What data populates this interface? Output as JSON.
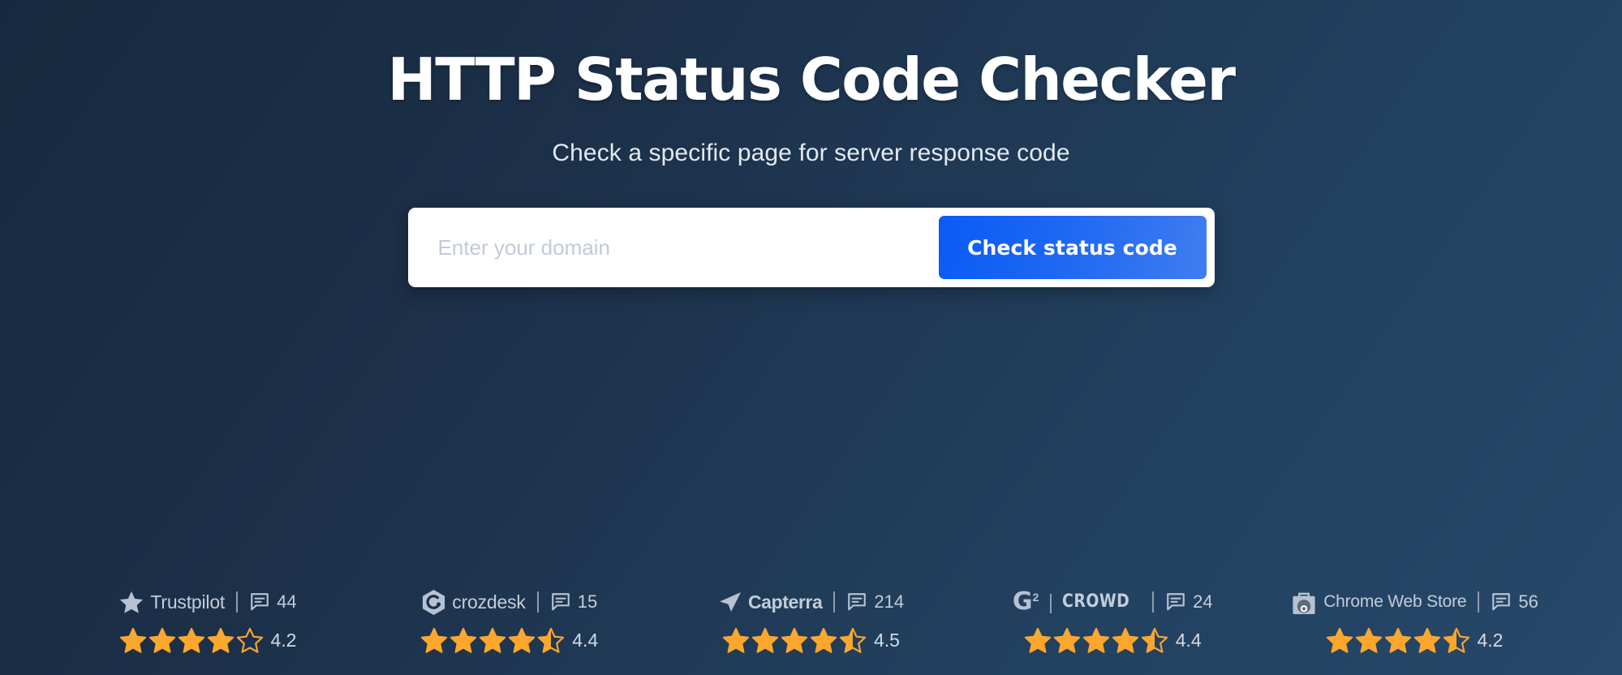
{
  "hero": {
    "title": "HTTP Status Code Checker",
    "subtitle": "Check a specific page for server response code"
  },
  "search": {
    "placeholder": "Enter your domain",
    "value": "",
    "button_label": "Check status code"
  },
  "colors": {
    "background_start": "#16293f",
    "background_end": "#27486a",
    "button_gradient_start": "#0a5bf6",
    "button_gradient_end": "#3f7df0",
    "star_filled": "#fba72e",
    "text_muted": "#c3ccd9"
  },
  "badges": [
    {
      "brand": "Trustpilot",
      "logo_icon": "star-icon",
      "review_icon": "comment-icon",
      "review_count": "44",
      "rating": "4.2",
      "stars": [
        "full",
        "full",
        "full",
        "full",
        "empty"
      ]
    },
    {
      "brand": "crozdesk",
      "logo_icon": "crozdesk-hexagon-icon",
      "review_icon": "comment-icon",
      "review_count": "15",
      "rating": "4.4",
      "stars": [
        "full",
        "full",
        "full",
        "full",
        "half"
      ]
    },
    {
      "brand": "Capterra",
      "logo_icon": "capterra-arrow-icon",
      "review_icon": "comment-icon",
      "review_count": "214",
      "rating": "4.5",
      "stars": [
        "full",
        "full",
        "full",
        "full",
        "half"
      ]
    },
    {
      "brand": "CROWD",
      "brand_prefix": "G",
      "brand_superscript": "2",
      "logo_icon": "g2-crowd-icon",
      "review_icon": "comment-icon",
      "review_count": "24",
      "rating": "4.4",
      "stars": [
        "full",
        "full",
        "full",
        "full",
        "half"
      ]
    },
    {
      "brand": "Chrome Web Store",
      "logo_icon": "chrome-web-store-bag-icon",
      "review_icon": "comment-icon",
      "review_count": "56",
      "rating": "4.2",
      "stars": [
        "full",
        "full",
        "full",
        "full",
        "half"
      ]
    }
  ]
}
